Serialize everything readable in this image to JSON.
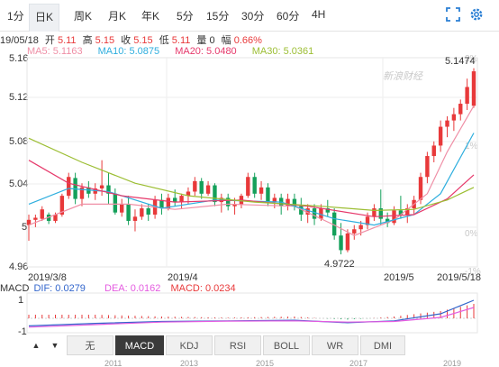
{
  "toolbar": {
    "tabs": [
      {
        "label": "1分",
        "active": false
      },
      {
        "label": "日K",
        "active": true
      },
      {
        "label": "周K",
        "active": false
      },
      {
        "label": "月K",
        "active": false
      },
      {
        "label": "年K",
        "active": false
      },
      {
        "label": "5分",
        "active": false
      },
      {
        "label": "15分",
        "active": false
      },
      {
        "label": "30分",
        "active": false
      },
      {
        "label": "60分",
        "active": false
      },
      {
        "label": "4H",
        "active": false
      }
    ],
    "icons": [
      "expand-icon",
      "settings-icon"
    ]
  },
  "info": {
    "date": "19/05/18",
    "open_label": "开",
    "open": "5.11",
    "high_label": "高",
    "high": "5.15",
    "close_label": "收",
    "close": "5.15",
    "low_label": "低",
    "low": "5.11",
    "vol_label": "量",
    "vol": "0",
    "chg_label": "幅",
    "chg": "0.66%"
  },
  "ma": {
    "ma5": "MA5: 5.1163",
    "ma10": "MA10: 5.0875",
    "ma20": "MA20: 5.0480",
    "ma30": "MA30: 5.0361"
  },
  "watermark": "新浪财经",
  "colors": {
    "up": "#e8393a",
    "down": "#14a05a",
    "ma5": "#ef8fa6",
    "ma10": "#2eaede",
    "ma20": "#e6396b",
    "ma30": "#9cbe33",
    "dif": "#3366cc",
    "dea": "#e45be0"
  },
  "chart_data": {
    "type": "candlestick",
    "y_axis_labels": [
      "5.16",
      "5.12",
      "5.08",
      "5.04",
      "5",
      "4.96"
    ],
    "right_axis_labels": [
      "2%",
      "1%",
      "0%",
      "-1%"
    ],
    "x_axis_labels": [
      "2019/3/8",
      "2019/4",
      "2019/5",
      "2019/5/18"
    ],
    "ylim": [
      4.96,
      5.16
    ],
    "annotations": {
      "max": "5.1474",
      "min": "4.9722"
    },
    "candles": [
      [
        5.0,
        5.01,
        4.985,
        5.005
      ],
      [
        5.005,
        5.01,
        4.998,
        5.007
      ],
      [
        5.006,
        5.018,
        5.004,
        5.015
      ],
      [
        5.01,
        5.012,
        5.001,
        5.004
      ],
      [
        5.004,
        5.012,
        5.002,
        5.01
      ],
      [
        5.01,
        5.03,
        5.008,
        5.028
      ],
      [
        5.028,
        5.05,
        5.025,
        5.046
      ],
      [
        5.045,
        5.05,
        5.02,
        5.025
      ],
      [
        5.025,
        5.04,
        5.018,
        5.036
      ],
      [
        5.036,
        5.042,
        5.026,
        5.03
      ],
      [
        5.03,
        5.04,
        5.024,
        5.035
      ],
      [
        5.035,
        5.062,
        5.028,
        5.038
      ],
      [
        5.038,
        5.05,
        5.02,
        5.03
      ],
      [
        5.03,
        5.035,
        5.01,
        5.012
      ],
      [
        5.012,
        5.025,
        5.008,
        5.02
      ],
      [
        5.02,
        5.028,
        5.0,
        5.004
      ],
      [
        5.004,
        5.015,
        4.994,
        5.008
      ],
      [
        5.008,
        5.02,
        5.005,
        5.016
      ],
      [
        5.016,
        5.02,
        5.004,
        5.01
      ],
      [
        5.01,
        5.028,
        5.006,
        5.024
      ],
      [
        5.024,
        5.03,
        5.01,
        5.016
      ],
      [
        5.016,
        5.03,
        5.014,
        5.026
      ],
      [
        5.026,
        5.034,
        5.018,
        5.022
      ],
      [
        5.022,
        5.03,
        5.016,
        5.028
      ],
      [
        5.028,
        5.036,
        5.02,
        5.032
      ],
      [
        5.032,
        5.046,
        5.028,
        5.042
      ],
      [
        5.042,
        5.045,
        5.025,
        5.03
      ],
      [
        5.03,
        5.042,
        5.028,
        5.038
      ],
      [
        5.038,
        5.04,
        5.018,
        5.022
      ],
      [
        5.022,
        5.03,
        5.012,
        5.026
      ],
      [
        5.026,
        5.03,
        5.014,
        5.018
      ],
      [
        5.018,
        5.026,
        5.01,
        5.02
      ],
      [
        5.02,
        5.03,
        5.016,
        5.028
      ],
      [
        5.028,
        5.05,
        5.026,
        5.046
      ],
      [
        5.046,
        5.05,
        5.026,
        5.03
      ],
      [
        5.03,
        5.042,
        5.024,
        5.036
      ],
      [
        5.036,
        5.04,
        5.018,
        5.022
      ],
      [
        5.022,
        5.03,
        5.016,
        5.026
      ],
      [
        5.026,
        5.03,
        5.01,
        5.018
      ],
      [
        5.018,
        5.03,
        5.014,
        5.025
      ],
      [
        5.025,
        5.03,
        5.014,
        5.018
      ],
      [
        5.018,
        5.026,
        5.004,
        5.01
      ],
      [
        5.01,
        5.02,
        5.002,
        5.016
      ],
      [
        5.016,
        5.02,
        5.0,
        5.006
      ],
      [
        5.006,
        5.02,
        5.004,
        5.016
      ],
      [
        5.016,
        5.024,
        5.008,
        5.012
      ],
      [
        5.012,
        5.016,
        4.986,
        4.99
      ],
      [
        4.99,
        5.002,
        4.972,
        4.976
      ],
      [
        4.976,
        4.996,
        4.974,
        4.992
      ],
      [
        4.992,
        5.0,
        4.986,
        4.996
      ],
      [
        4.996,
        5.004,
        4.99,
        5.0
      ],
      [
        5.0,
        5.012,
        4.996,
        5.008
      ],
      [
        5.008,
        5.02,
        5.004,
        5.016
      ],
      [
        5.016,
        5.034,
        5.0,
        5.006
      ],
      [
        5.006,
        5.012,
        4.998,
        5.002
      ],
      [
        5.002,
        5.018,
        5.0,
        5.014
      ],
      [
        5.014,
        5.028,
        5.006,
        5.01
      ],
      [
        5.01,
        5.02,
        5.002,
        5.016
      ],
      [
        5.016,
        5.028,
        5.01,
        5.024
      ],
      [
        5.024,
        5.05,
        5.02,
        5.046
      ],
      [
        5.046,
        5.07,
        5.04,
        5.066
      ],
      [
        5.066,
        5.08,
        5.06,
        5.076
      ],
      [
        5.076,
        5.1,
        5.07,
        5.094
      ],
      [
        5.094,
        5.104,
        5.084,
        5.1
      ],
      [
        5.1,
        5.112,
        5.09,
        5.106
      ],
      [
        5.106,
        5.12,
        5.1,
        5.116
      ],
      [
        5.116,
        5.14,
        5.11,
        5.132
      ],
      [
        5.114,
        5.15,
        5.112,
        5.147
      ]
    ],
    "ma_series": {
      "MA5": [
        [
          0,
          5.0
        ],
        [
          8,
          5.02
        ],
        [
          15,
          5.02
        ],
        [
          22,
          5.015
        ],
        [
          30,
          5.02
        ],
        [
          40,
          5.018
        ],
        [
          46,
          5.0
        ],
        [
          49,
          4.99
        ],
        [
          55,
          5.005
        ],
        [
          60,
          5.03
        ],
        [
          63,
          5.07
        ],
        [
          67,
          5.114
        ]
      ],
      "MA10": [
        [
          0,
          5.02
        ],
        [
          6,
          5.035
        ],
        [
          12,
          5.032
        ],
        [
          20,
          5.016
        ],
        [
          28,
          5.024
        ],
        [
          38,
          5.022
        ],
        [
          46,
          5.006
        ],
        [
          52,
          5.0
        ],
        [
          58,
          5.01
        ],
        [
          62,
          5.03
        ],
        [
          67,
          5.088
        ]
      ],
      "MA20": [
        [
          0,
          5.062
        ],
        [
          6,
          5.04
        ],
        [
          14,
          5.028
        ],
        [
          22,
          5.022
        ],
        [
          32,
          5.024
        ],
        [
          42,
          5.018
        ],
        [
          52,
          5.008
        ],
        [
          58,
          5.01
        ],
        [
          63,
          5.025
        ],
        [
          67,
          5.048
        ]
      ],
      "MA30": [
        [
          0,
          5.083
        ],
        [
          8,
          5.06
        ],
        [
          16,
          5.04
        ],
        [
          24,
          5.028
        ],
        [
          34,
          5.022
        ],
        [
          44,
          5.018
        ],
        [
          52,
          5.014
        ],
        [
          58,
          5.015
        ],
        [
          63,
          5.024
        ],
        [
          67,
          5.036
        ]
      ]
    }
  },
  "macd": {
    "dif": "DIF: 0.0279",
    "dea": "DEA: 0.0162",
    "macd": "MACD: 0.0234",
    "title": "MACD",
    "y_labels": [
      "1",
      "-1"
    ],
    "dif_series": [
      [
        0,
        -0.6
      ],
      [
        10,
        -0.4
      ],
      [
        20,
        -0.25
      ],
      [
        30,
        -0.2
      ],
      [
        40,
        -0.15
      ],
      [
        48,
        -0.35
      ],
      [
        55,
        -0.2
      ],
      [
        62,
        0.25
      ],
      [
        67,
        1.0
      ]
    ],
    "dea_series": [
      [
        0,
        -0.7
      ],
      [
        10,
        -0.5
      ],
      [
        20,
        -0.3
      ],
      [
        30,
        -0.22
      ],
      [
        40,
        -0.2
      ],
      [
        48,
        -0.3
      ],
      [
        55,
        -0.25
      ],
      [
        62,
        0.05
      ],
      [
        67,
        0.6
      ]
    ]
  },
  "bottom_tabs": [
    "无",
    "MACD",
    "KDJ",
    "RSI",
    "BOLL",
    "WR",
    "DMI"
  ],
  "bottom_active": "MACD",
  "bottom_years": [
    "2011",
    "2013",
    "2015",
    "2017",
    "2019"
  ]
}
